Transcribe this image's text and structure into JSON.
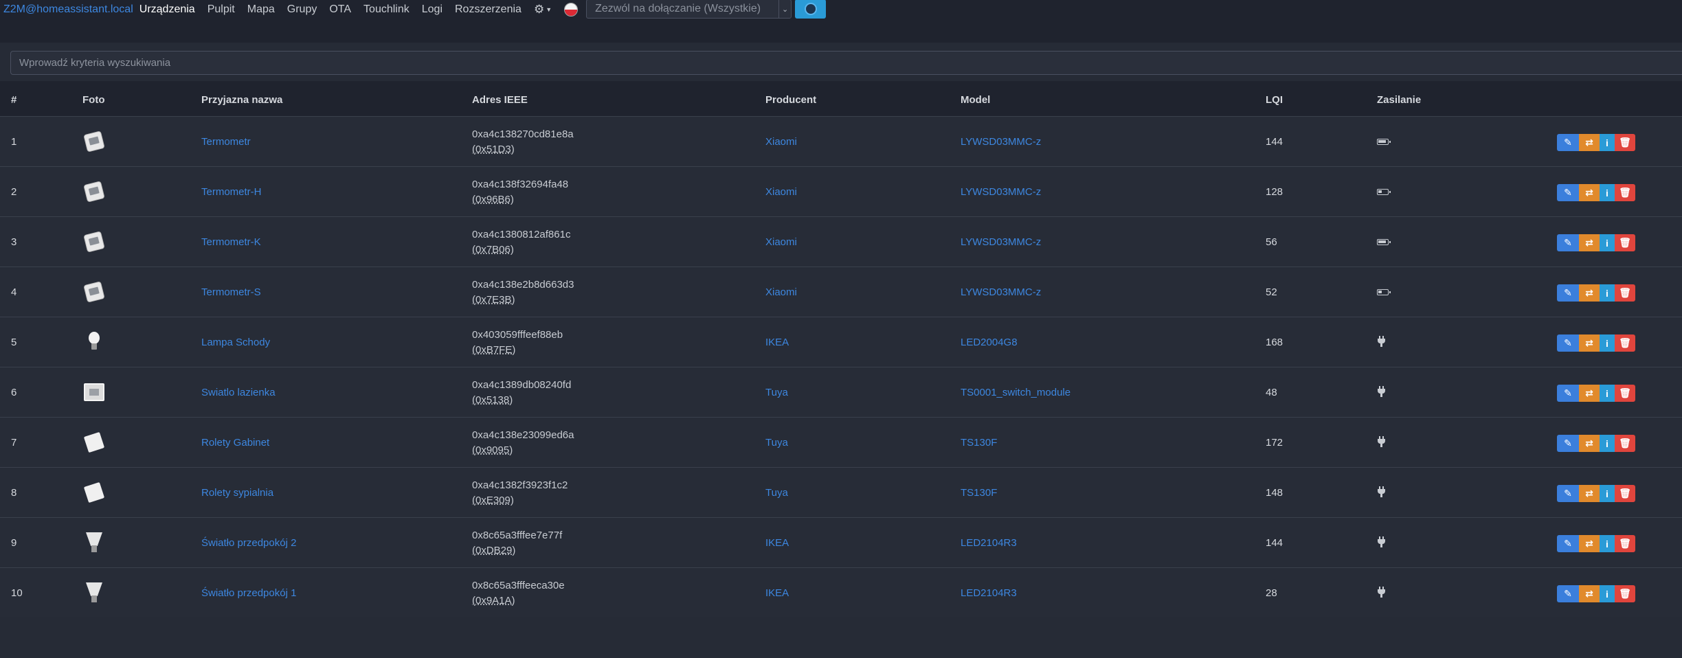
{
  "navbar": {
    "brand": "Z2M@homeassistant.local",
    "links": [
      "Urządzenia",
      "Pulpit",
      "Mapa",
      "Grupy",
      "OTA",
      "Touchlink",
      "Logi",
      "Rozszerzenia"
    ],
    "active_link": "Urządzenia",
    "settings_icon": "gear-icon",
    "language_icon": "poland-flag-icon",
    "permit_join_label": "Zezwól na dołączanie (Wszystkie)",
    "permit_join_button_icon": "power-circle-icon"
  },
  "search": {
    "placeholder": "Wprowadź kryteria wyszukiwania",
    "value": ""
  },
  "table": {
    "headers": [
      "#",
      "Foto",
      "Przyjazna nazwa",
      "Adres IEEE",
      "Producent",
      "Model",
      "LQI",
      "Zasilanie"
    ],
    "rows": [
      {
        "index": "1",
        "image": "temperature-sensor",
        "name": "Termometr",
        "ieee": "0xa4c138270cd81e8a",
        "nwk": "(0x51D3)",
        "vendor": "Xiaomi",
        "model": "LYWSD03MMC-z",
        "lqi": "144",
        "power": "battery",
        "battery_level": 0.85
      },
      {
        "index": "2",
        "image": "temperature-sensor",
        "name": "Termometr-H",
        "ieee": "0xa4c138f32694fa48",
        "nwk": "(0x96B6)",
        "vendor": "Xiaomi",
        "model": "LYWSD03MMC-z",
        "lqi": "128",
        "power": "battery",
        "battery_level": 0.35
      },
      {
        "index": "3",
        "image": "temperature-sensor",
        "name": "Termometr-K",
        "ieee": "0xa4c1380812af861c",
        "nwk": "(0x7B06)",
        "vendor": "Xiaomi",
        "model": "LYWSD03MMC-z",
        "lqi": "56",
        "power": "battery",
        "battery_level": 0.85
      },
      {
        "index": "4",
        "image": "temperature-sensor",
        "name": "Termometr-S",
        "ieee": "0xa4c138e2b8d663d3",
        "nwk": "(0x7E3B)",
        "vendor": "Xiaomi",
        "model": "LYWSD03MMC-z",
        "lqi": "52",
        "power": "battery",
        "battery_level": 0.35
      },
      {
        "index": "5",
        "image": "bulb",
        "name": "Lampa Schody",
        "ieee": "0x403059fffeef88eb",
        "nwk": "(0xB7FE)",
        "vendor": "IKEA",
        "model": "LED2004G8",
        "lqi": "168",
        "power": "mains"
      },
      {
        "index": "6",
        "image": "switch-module",
        "name": "Swiatlo lazienka",
        "ieee": "0xa4c1389db08240fd",
        "nwk": "(0x5138)",
        "vendor": "Tuya",
        "model": "TS0001_switch_module",
        "lqi": "48",
        "power": "mains"
      },
      {
        "index": "7",
        "image": "wall-switch",
        "name": "Rolety Gabinet",
        "ieee": "0xa4c138e23099ed6a",
        "nwk": "(0x9095)",
        "vendor": "Tuya",
        "model": "TS130F",
        "lqi": "172",
        "power": "mains"
      },
      {
        "index": "8",
        "image": "wall-switch",
        "name": "Rolety sypialnia",
        "ieee": "0xa4c1382f3923f1c2",
        "nwk": "(0xE309)",
        "vendor": "Tuya",
        "model": "TS130F",
        "lqi": "148",
        "power": "mains"
      },
      {
        "index": "9",
        "image": "spot-bulb",
        "name": "Światło przedpokój 2",
        "ieee": "0x8c65a3fffee7e77f",
        "nwk": "(0xDB29)",
        "vendor": "IKEA",
        "model": "LED2104R3",
        "lqi": "144",
        "power": "mains"
      },
      {
        "index": "10",
        "image": "spot-bulb",
        "name": "Światło przedpokój 1",
        "ieee": "0x8c65a3fffeeca30e",
        "nwk": "(0x9A1A)",
        "vendor": "IKEA",
        "model": "LED2104R3",
        "lqi": "28",
        "power": "mains"
      }
    ],
    "action_icons": [
      "edit-icon",
      "rename-icon",
      "info-icon",
      "trash-icon"
    ]
  },
  "colors": {
    "background": "#1f232e",
    "row_background": "#272c37",
    "link": "#3d87e0",
    "edit": "#3b7fdc",
    "rename": "#e18a2c",
    "info": "#2a9bd7",
    "delete": "#e0453d"
  }
}
